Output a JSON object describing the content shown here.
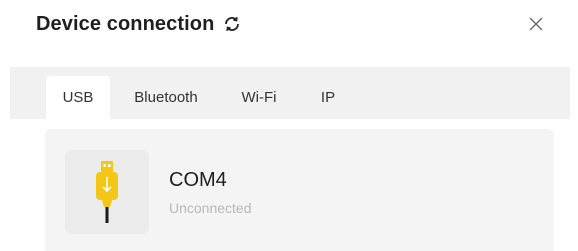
{
  "header": {
    "title": "Device connection",
    "refresh_icon": "refresh-icon",
    "close_icon": "close-icon"
  },
  "tabs": [
    {
      "label": "USB",
      "active": true
    },
    {
      "label": "Bluetooth",
      "active": false
    },
    {
      "label": "Wi-Fi",
      "active": false
    },
    {
      "label": "IP",
      "active": false
    }
  ],
  "device": {
    "name": "COM4",
    "status": "Unconnected",
    "icon": "usb-drive-icon"
  },
  "colors": {
    "usb_yellow": "#f5c518",
    "status_text": "#b7b7b7",
    "tab_bar_bg": "#f1f1f1",
    "card_bg": "#f4f4f4"
  }
}
